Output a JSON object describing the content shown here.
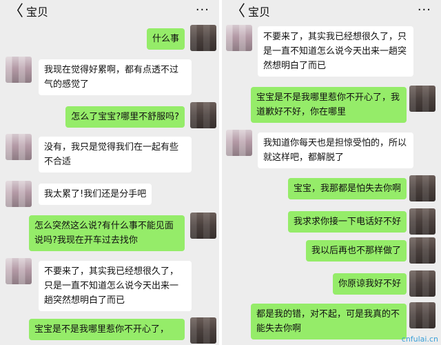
{
  "left": {
    "title": "宝贝",
    "back_icon": "chevron-left-icon",
    "more_icon": "more-dots-icon",
    "messages": [
      "什么事",
      "我现在觉得好累啊，都有点透不过气的感觉了",
      "怎么了宝宝?哪里不舒服吗?",
      "没有，我只是觉得我们在一起有些不合适",
      "我太累了!我们还是分手吧",
      "怎么突然这么说?有什么事不能见面说吗?我现在开车过去找你",
      "不要来了，其实我已经想很久了，只是一直不知道怎么说今天出来一趟突然想明白了而已",
      "宝宝是不是我哪里惹你不开心了，"
    ]
  },
  "right": {
    "title": "宝贝",
    "back_icon": "chevron-left-icon",
    "more_icon": "more-dots-icon",
    "messages": [
      "不要来了，其实我已经想很久了，只是一直不知道怎么说今天出来一趟突然想明白了而已",
      "宝宝是不是我哪里惹你不开心了，我道歉好不好，你在哪里",
      "我知道你每天也是担惊受怕的，所以就这样吧，都解脱了",
      "宝宝，我那都是怕失去你啊",
      "我求求你接一下电话好不好",
      "我以后再也不那样做了",
      "你原谅我好不好",
      "都是我的错，对不起，可是我真的不能失去你啊"
    ]
  },
  "glyphs": {
    "back": "〈",
    "more": "···"
  },
  "watermark": "cnfulai.cn",
  "colors": {
    "bubble_out": "#95ec69",
    "bubble_in": "#ffffff",
    "background": "#ededed"
  }
}
